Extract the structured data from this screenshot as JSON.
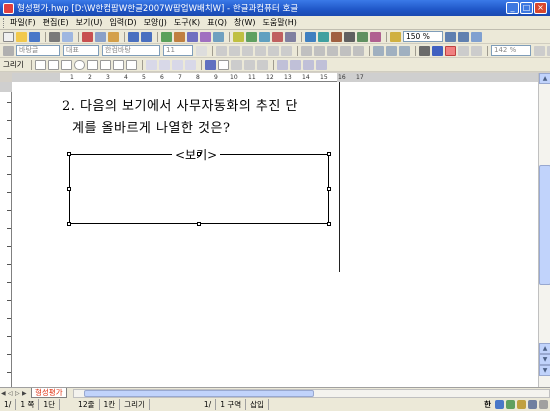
{
  "window": {
    "title": "형성평가.hwp [D:\\W한컴팝W한글2007W팝업W배치W] - 한글과컴퓨터 호글",
    "buttons": {
      "minimize": "_",
      "maximize": "□",
      "close": "×"
    }
  },
  "menu": [
    "파일(F)",
    "편집(E)",
    "보기(U)",
    "입력(D)",
    "모양(J)",
    "도구(K)",
    "표(Q)",
    "창(W)",
    "도움말(H)"
  ],
  "toolbar": {
    "style_combo": "바탕글",
    "lang_combo": "대표",
    "font_combo": "한컴바탕",
    "size_combo": "11",
    "zoom": "150 %",
    "width_combo": "142 %",
    "draw_label": "그리기"
  },
  "ruler": {
    "numbers": [
      "1",
      "2",
      "3",
      "4",
      "5",
      "6",
      "7",
      "8",
      "9",
      "10",
      "11",
      "12",
      "13",
      "14",
      "15",
      "16",
      "17"
    ]
  },
  "document": {
    "question_line1": "2. 다음의 보기에서 사무자동화의 추진 단",
    "question_line2": "계를 올바르게 나열한 것은?",
    "box_label": "<보기>"
  },
  "tabs": {
    "active": "형성평가"
  },
  "status": {
    "page": "1/",
    "page_total": "1 쪽",
    "section": "1단",
    "line": "12줄",
    "col": "1칸",
    "mode_label": "그리기",
    "section_count": "1/",
    "section_label": "1 구역",
    "insert": "삽입",
    "ime": "한"
  },
  "colors": {
    "titlebar": "#1f56c7",
    "accent_red": "#e03010",
    "chrome": "#ece9d8"
  }
}
